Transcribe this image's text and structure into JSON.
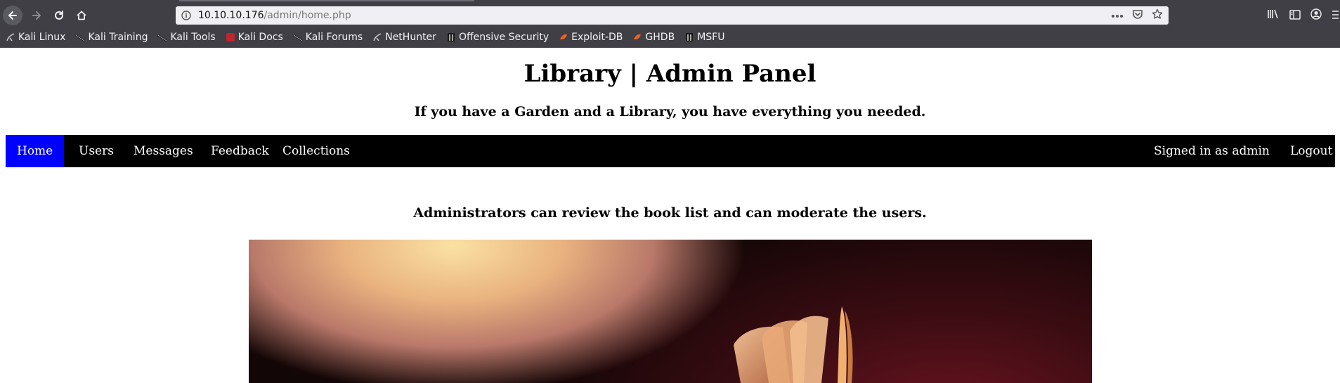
{
  "browser": {
    "url_host": "10.10.10.176",
    "url_path": "/admin/home.php",
    "bookmarks": [
      {
        "label": "Kali Linux",
        "icon": "kali-dragon-icon"
      },
      {
        "label": "Kali Training",
        "icon": "kali-dragon-icon"
      },
      {
        "label": "Kali Tools",
        "icon": "kali-dragon-icon"
      },
      {
        "label": "Kali Docs",
        "icon": "kali-docs-icon"
      },
      {
        "label": "Kali Forums",
        "icon": "kali-dragon-icon"
      },
      {
        "label": "NetHunter",
        "icon": "nethunter-icon"
      },
      {
        "label": "Offensive Security",
        "icon": "offsec-icon"
      },
      {
        "label": "Exploit-DB",
        "icon": "exploitdb-icon"
      },
      {
        "label": "GHDB",
        "icon": "ghdb-icon"
      },
      {
        "label": "MSFU",
        "icon": "offsec-icon"
      }
    ]
  },
  "page": {
    "title": "Library | Admin Panel",
    "tagline": "If you have a Garden and a Library, you have everything you needed.",
    "nav": {
      "home": "Home",
      "users": "Users",
      "messages": "Messages",
      "feedback": "Feedback",
      "collections": "Collections",
      "signed_in": "Signed in as admin",
      "logout": "Logout"
    },
    "lead": "Administrators can review the book list and can moderate the users."
  },
  "colors": {
    "chrome_bg": "#3f3f45",
    "nav_bg": "#000000",
    "nav_active": "#0000ff"
  }
}
